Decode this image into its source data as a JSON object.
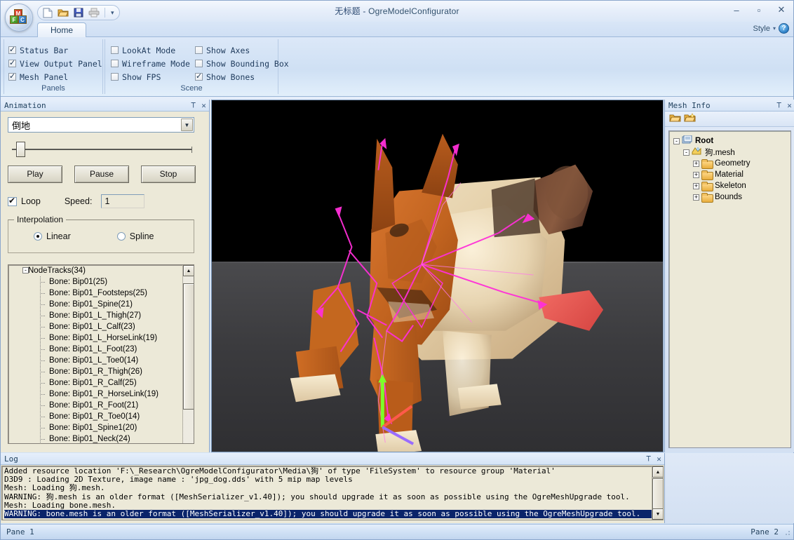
{
  "window": {
    "title_document": "无标题",
    "title_sep": " - ",
    "title_app": "OgreModelConfigurator",
    "minimize": "–",
    "maximize": "▫",
    "close": "✕"
  },
  "quick_access": {
    "items": [
      {
        "name": "new-document-icon",
        "tooltip": "New"
      },
      {
        "name": "open-folder-icon",
        "tooltip": "Open"
      },
      {
        "name": "save-disk-icon",
        "tooltip": "Save"
      },
      {
        "name": "print-icon",
        "tooltip": "Print"
      }
    ],
    "more": "▾"
  },
  "ribbon": {
    "tab_home": "Home",
    "style_label": "Style",
    "style_caret": "▾",
    "help_label": "?",
    "groups": [
      {
        "label": "Panels",
        "checkboxes": [
          {
            "label": "Status Bar",
            "checked": true
          },
          {
            "label": "View Output Panel",
            "checked": true
          },
          {
            "label": "Mesh Panel",
            "checked": true
          }
        ]
      },
      {
        "label": "Scene",
        "col_a": [
          {
            "label": "LookAt Mode",
            "checked": false
          },
          {
            "label": "Wireframe Mode",
            "checked": false
          },
          {
            "label": "Show FPS",
            "checked": false
          }
        ],
        "col_b": [
          {
            "label": "Show Axes",
            "checked": false
          },
          {
            "label": "Show Bounding Box",
            "checked": false
          },
          {
            "label": "Show Bones",
            "checked": true
          }
        ]
      }
    ]
  },
  "animation": {
    "title": "Animation",
    "pin": "pin-icon",
    "close": "✕",
    "combo_value": "倒地",
    "combo_arrow": "▼",
    "slider_value": 0,
    "buttons": {
      "play": "Play",
      "pause": "Pause",
      "stop": "Stop"
    },
    "loop_label": "Loop",
    "loop_checked": true,
    "speed_label": "Speed:",
    "speed_value": "1",
    "interpolation": {
      "title": "Interpolation",
      "options": [
        {
          "label": "Linear",
          "selected": true
        },
        {
          "label": "Spline",
          "selected": false
        }
      ]
    },
    "tree": {
      "root": "NodeTracks(34)",
      "root_expander": "-",
      "items": [
        "Bone: Bip01(25)",
        "Bone: Bip01_Footsteps(25)",
        "Bone: Bip01_Spine(21)",
        "Bone: Bip01_L_Thigh(27)",
        "Bone: Bip01_L_Calf(23)",
        "Bone: Bip01_L_HorseLink(19)",
        "Bone: Bip01_L_Foot(23)",
        "Bone: Bip01_L_Toe0(14)",
        "Bone: Bip01_R_Thigh(26)",
        "Bone: Bip01_R_Calf(25)",
        "Bone: Bip01_R_HorseLink(19)",
        "Bone: Bip01_R_Foot(21)",
        "Bone: Bip01_R_Toe0(14)",
        "Bone: Bip01_Spine1(20)",
        "Bone: Bip01_Neck(24)"
      ],
      "scroll_up": "▲"
    }
  },
  "mesh_info": {
    "title": "Mesh Info",
    "pin": "pin-icon",
    "close": "✕",
    "toolbar": [
      {
        "name": "open-folder-icon"
      },
      {
        "name": "new-folder-icon"
      }
    ],
    "tree": [
      {
        "label": "Root",
        "depth": 0,
        "expander": "-",
        "icon": "root-icon",
        "bold": true
      },
      {
        "label": "狗.mesh",
        "depth": 1,
        "expander": "-",
        "icon": "mesh-icon",
        "bold": false
      },
      {
        "label": "Geometry",
        "depth": 2,
        "expander": "+",
        "icon": "folder-icon",
        "bold": false
      },
      {
        "label": "Material",
        "depth": 2,
        "expander": "+",
        "icon": "folder-icon",
        "bold": false
      },
      {
        "label": "Skeleton",
        "depth": 2,
        "expander": "+",
        "icon": "folder-icon",
        "bold": false
      },
      {
        "label": "Bounds",
        "depth": 2,
        "expander": "+",
        "icon": "folder-icon",
        "bold": false
      }
    ]
  },
  "log": {
    "title": "Log",
    "pin": "pin-icon",
    "close": "✕",
    "lines": [
      {
        "text": "Added resource location 'F:\\_Research\\OgreModelConfigurator\\Media\\狗' of type 'FileSystem' to resource group 'Material'",
        "selected": false
      },
      {
        "text": "D3D9 : Loading 2D Texture, image name : 'jpg_dog.dds' with 5 mip map levels",
        "selected": false
      },
      {
        "text": "Mesh: Loading 狗.mesh.",
        "selected": false
      },
      {
        "text": "WARNING: 狗.mesh is an older format ([MeshSerializer_v1.40]); you should upgrade it as soon as possible using the OgreMeshUpgrade tool.",
        "selected": false
      },
      {
        "text": "Mesh: Loading bone.mesh.",
        "selected": false
      },
      {
        "text": "WARNING: bone.mesh is an older format ([MeshSerializer_v1.40]); you should upgrade it as soon as possible using the OgreMeshUpgrade tool.",
        "selected": true
      }
    ],
    "scroll_up": "▲",
    "scroll_down": "▼"
  },
  "status_bar": {
    "pane1": "Pane 1",
    "pane2": "Pane 2"
  },
  "viewport": {
    "name": "3d-render-viewport",
    "model": "狗.mesh",
    "background_color": "#000000",
    "floor_color": "#3f3f42",
    "bone_color": "#ff2fd8",
    "axis_colors": {
      "y": "#7dff2a",
      "x": "#ff5a4a",
      "z": "#9a6cff"
    }
  }
}
